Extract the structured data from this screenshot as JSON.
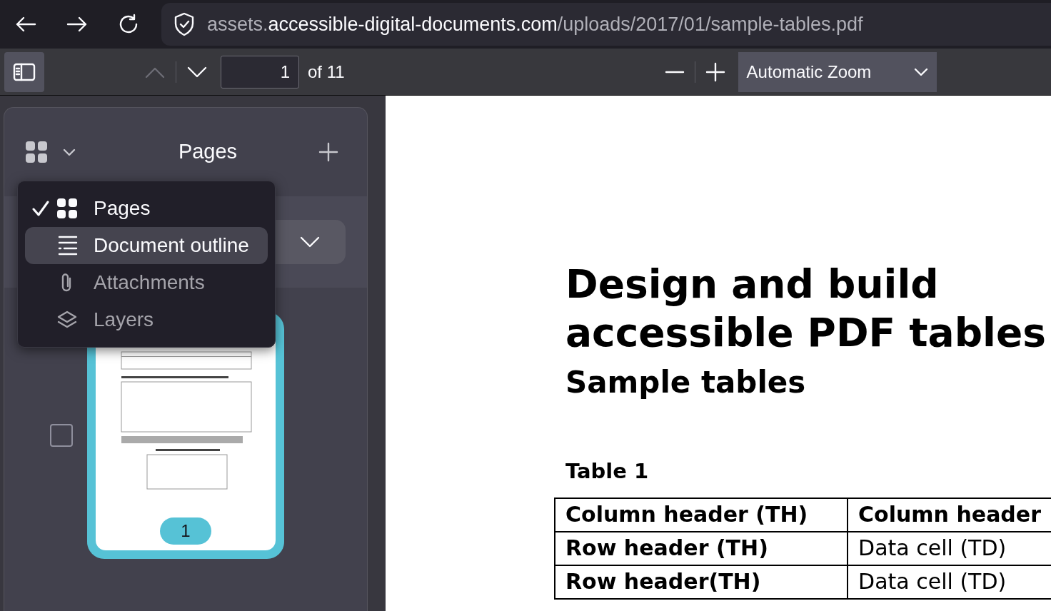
{
  "browser": {
    "url_prefix": "assets.",
    "url_domain": "accessible-digital-documents.com",
    "url_path": "/uploads/2017/01/sample-tables.pdf"
  },
  "toolbar": {
    "previous_disabled": true,
    "page_number": "1",
    "page_count": "of 11",
    "zoom": "Automatic Zoom"
  },
  "sidebar": {
    "title": "Pages",
    "view_menu": [
      {
        "kind": "pages",
        "label": "Pages",
        "checked": true,
        "highlighted": false,
        "disabled": false
      },
      {
        "kind": "outline",
        "label": "Document outline",
        "checked": false,
        "highlighted": true,
        "disabled": false
      },
      {
        "kind": "attachments",
        "label": "Attachments",
        "checked": false,
        "highlighted": false,
        "disabled": true
      },
      {
        "kind": "layers",
        "label": "Layers",
        "checked": false,
        "highlighted": false,
        "disabled": true
      }
    ],
    "thumbnails": [
      {
        "page": "1",
        "selected": true,
        "checked": false
      }
    ]
  },
  "document": {
    "title_lines": [
      "Design and build",
      "accessible PDF tables"
    ],
    "subtitle": "Sample tables",
    "table_caption": "Table 1",
    "table": {
      "rows": [
        {
          "header": true,
          "cells": [
            "Column header (TH)",
            "Column header"
          ]
        },
        {
          "header": false,
          "cells": [
            "Row header (TH)",
            "Data cell (TD)"
          ]
        },
        {
          "header": false,
          "cells": [
            "Row header(TH)",
            "Data cell (TD)"
          ]
        }
      ]
    }
  }
}
